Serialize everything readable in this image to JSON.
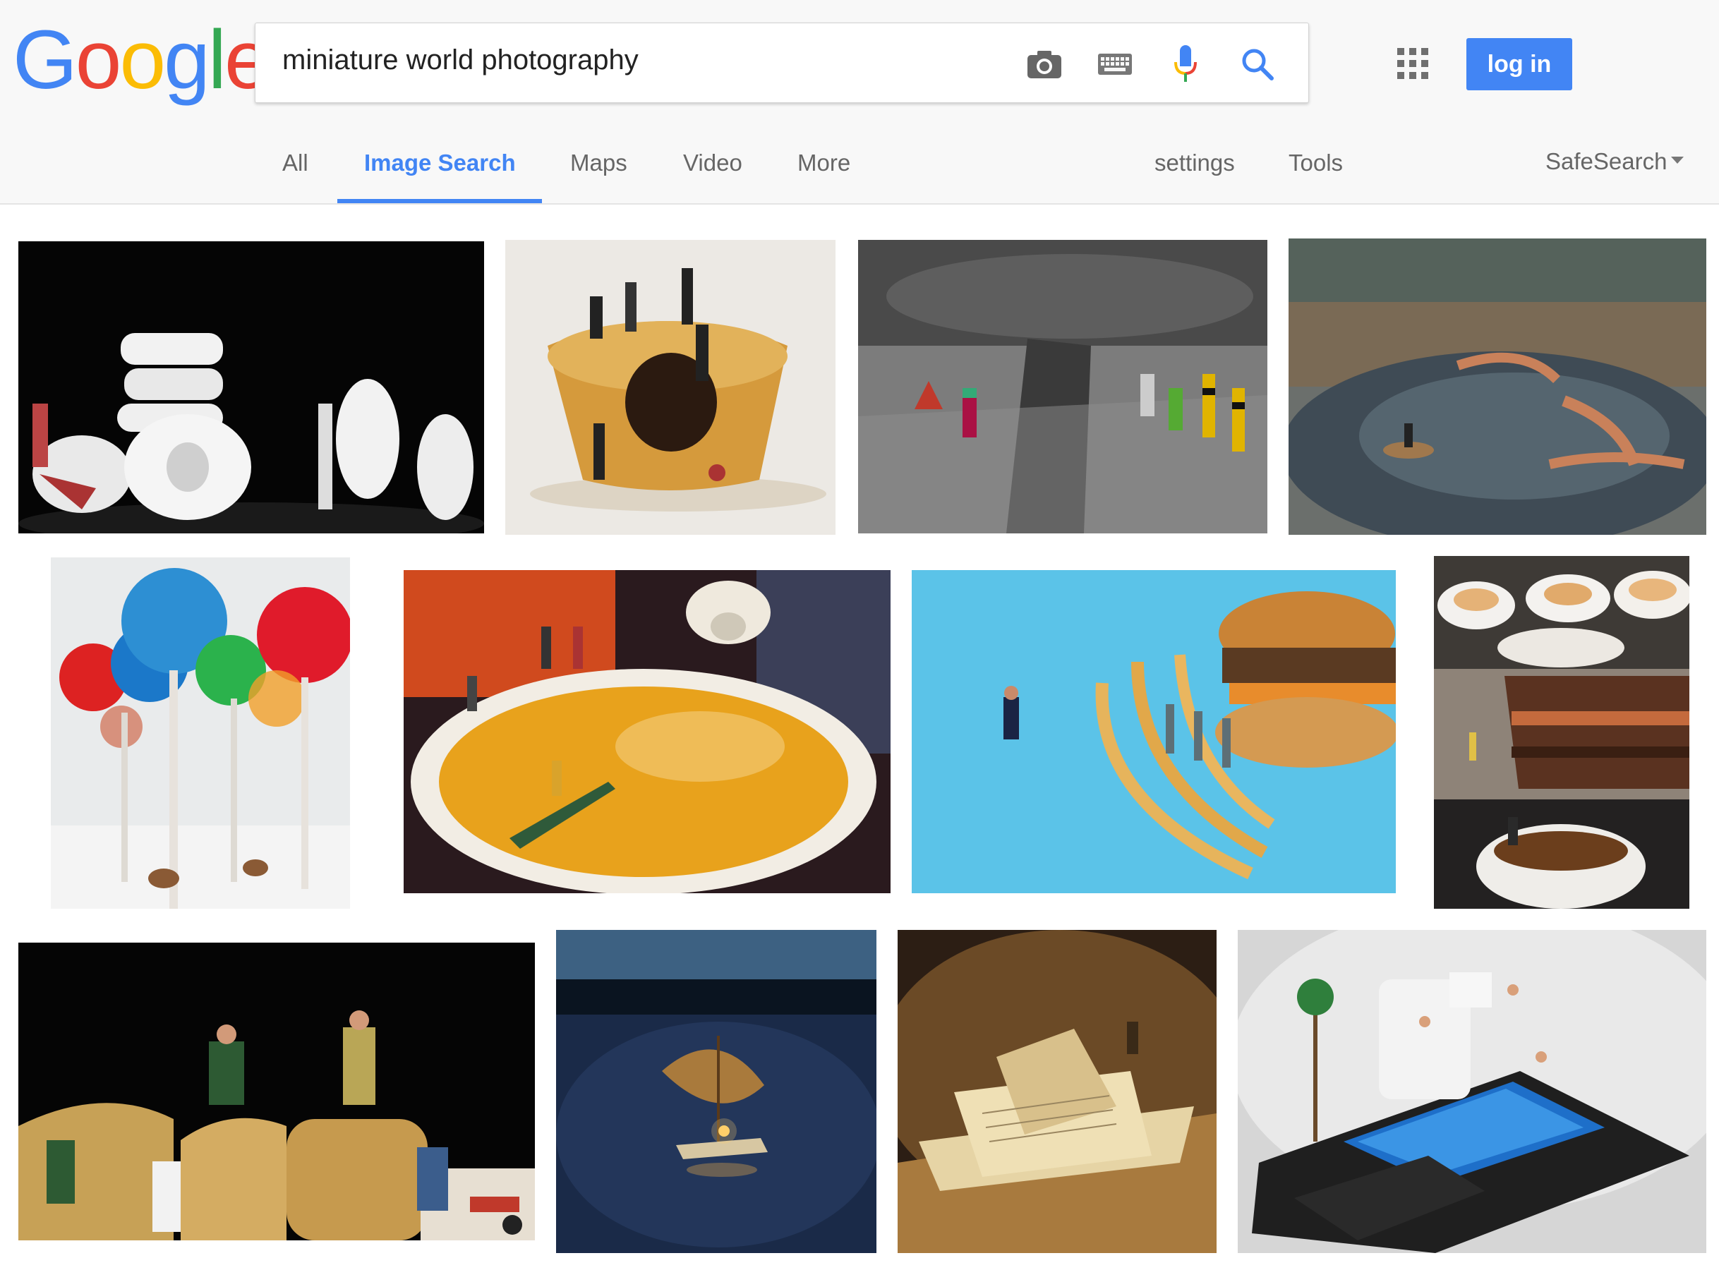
{
  "logo": {
    "letters": [
      "G",
      "o",
      "o",
      "g",
      "l",
      "e"
    ],
    "colors": [
      "#4285f4",
      "#ea4335",
      "#fbbc05",
      "#4285f4",
      "#34a853",
      "#ea4335"
    ]
  },
  "search": {
    "query": "miniature world photography"
  },
  "icons": {
    "camera": "camera-icon",
    "keyboard": "keyboard-icon",
    "mic": "microphone-icon",
    "search": "search-icon",
    "apps": "apps-grid-icon"
  },
  "header": {
    "login_label": "log in",
    "accent": "#4285f4"
  },
  "nav": {
    "tabs": [
      {
        "label": "All"
      },
      {
        "label": "Image Search"
      },
      {
        "label": "Maps"
      },
      {
        "label": "Video"
      },
      {
        "label": "More"
      }
    ],
    "settings_label": "settings",
    "tools_label": "Tools",
    "safesearch_label": "SafeSearch"
  },
  "results": [
    {
      "subject": "workers-with-mints"
    },
    {
      "subject": "workers-on-mince-pie"
    },
    {
      "subject": "roadworkers-on-cracked-asphalt"
    },
    {
      "subject": "crab-and-canoe-in-puddle"
    },
    {
      "subject": "deer-among-lollipops"
    },
    {
      "subject": "canoe-in-tea-cup"
    },
    {
      "subject": "workers-on-fries-and-burger"
    },
    {
      "subject": "pancakes-cake-espresso-collage"
    },
    {
      "subject": "workers-on-bread-crumbs"
    },
    {
      "subject": "leaf-raft-at-night"
    },
    {
      "subject": "paper-boat-on-book"
    },
    {
      "subject": "swimmers-on-smartphone"
    }
  ]
}
